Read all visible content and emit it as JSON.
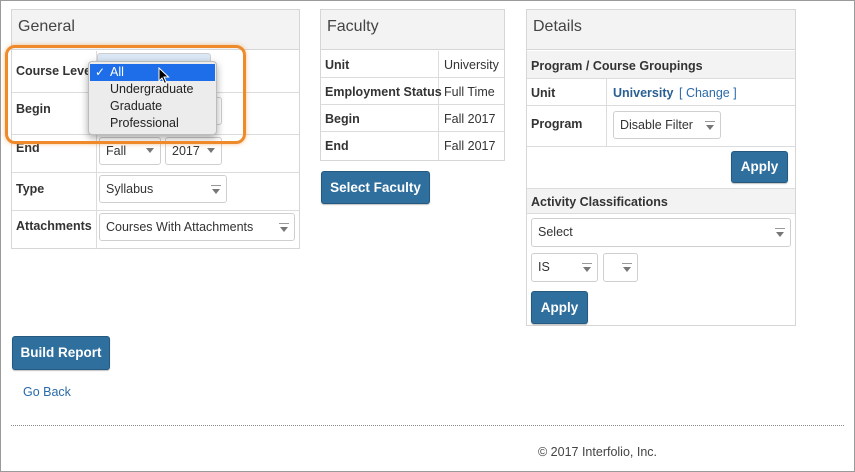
{
  "general": {
    "title": "General",
    "course_level_label": "Course Level",
    "begin_label": "Begin",
    "end_label": "End",
    "end_term_value": "Fall",
    "end_year_value": "2017",
    "type_label": "Type",
    "type_value": "Syllabus",
    "attachments_label": "Attachments",
    "attachments_value": "Courses With Attachments",
    "course_level_options": [
      "All",
      "Undergraduate",
      "Graduate",
      "Professional"
    ],
    "course_level_selected": "All"
  },
  "faculty": {
    "title": "Faculty",
    "rows": [
      {
        "label": "Unit",
        "value": "University"
      },
      {
        "label": "Employment Status",
        "value": "Full Time"
      },
      {
        "label": "Begin",
        "value": "Fall 2017"
      },
      {
        "label": "End",
        "value": "Fall 2017"
      }
    ],
    "select_button": "Select Faculty"
  },
  "details": {
    "title": "Details",
    "program_groupings_heading": "Program / Course Groupings",
    "unit_label": "Unit",
    "unit_value": "University",
    "change_link": "[ Change ]",
    "program_label": "Program",
    "program_value": "Disable Filter",
    "apply_label": "Apply",
    "activity_heading": "Activity Classifications",
    "activity_select": "Select",
    "operator_value": "IS",
    "apply2_label": "Apply"
  },
  "actions": {
    "build_report": "Build Report",
    "go_back": "Go Back"
  },
  "footer": {
    "copyright": "© 2017 Interfolio, Inc."
  },
  "colors": {
    "primary_button": "#2e6f9e",
    "highlight": "#ef8a2a",
    "dropdown_selected": "#1d6ee8"
  }
}
